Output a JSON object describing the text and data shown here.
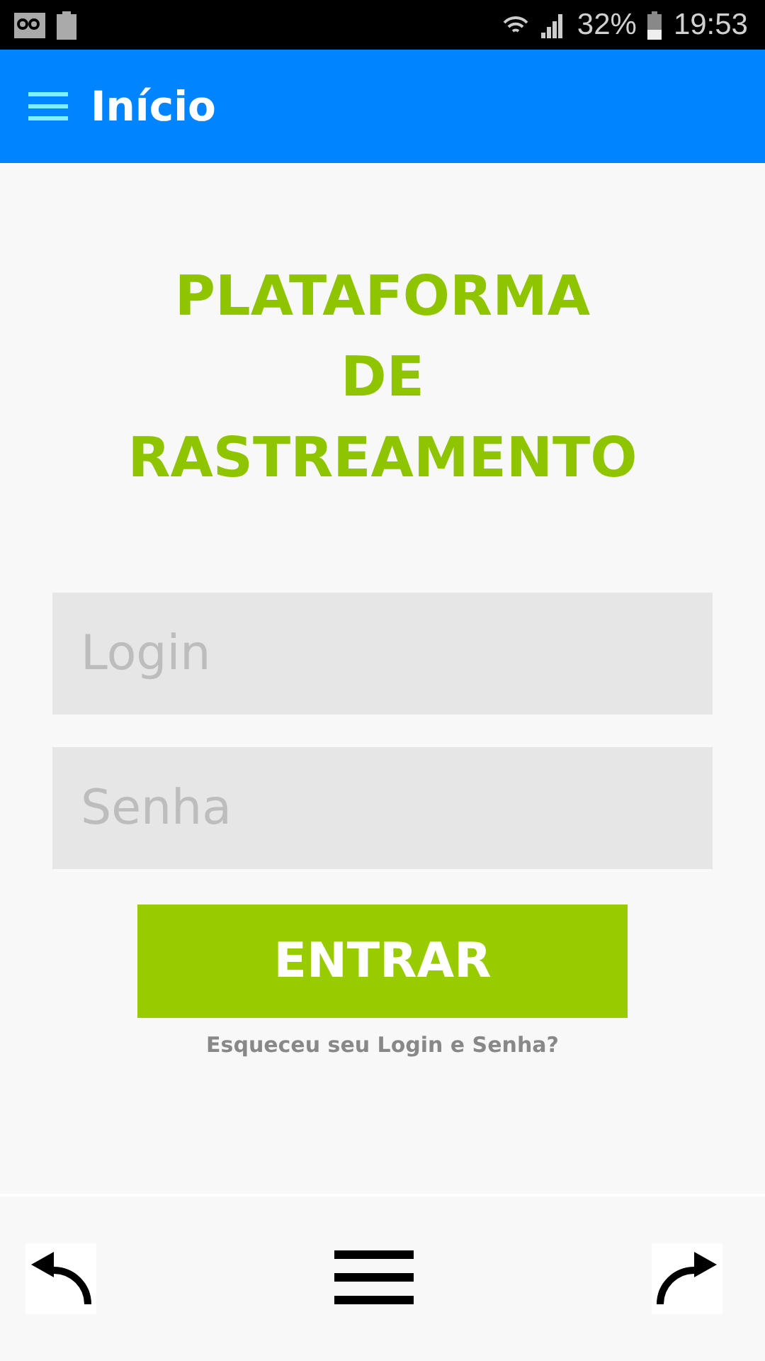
{
  "status_bar": {
    "battery": "32%",
    "time": "19:53"
  },
  "app_bar": {
    "title": "Início"
  },
  "title_lines": [
    "PLATAFORMA",
    "DE",
    "RASTREAMENTO"
  ],
  "login_field": {
    "placeholder": "Login"
  },
  "password_field": {
    "placeholder": "Senha"
  },
  "submit_button": "ENTRAR",
  "forgot_link": "Esqueceu seu Login e Senha?"
}
